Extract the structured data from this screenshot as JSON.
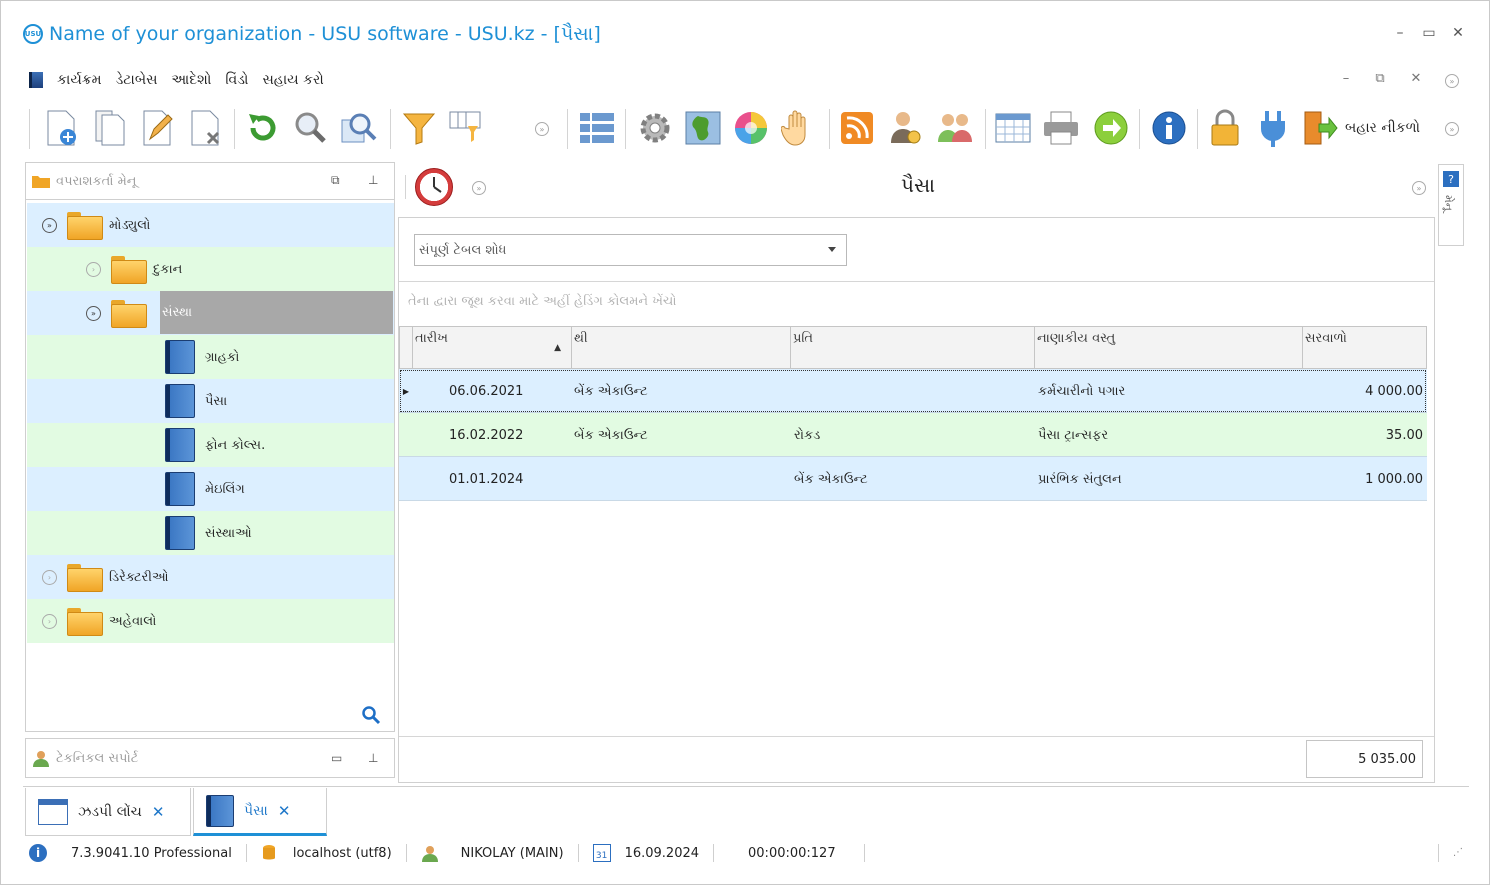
{
  "window": {
    "title": "Name of your organization - USU software - USU.kz - [પૈસા]",
    "logo_text": "USU"
  },
  "menu": {
    "items": [
      "કાર્યક્રમ",
      "ડેટાબેસ",
      "આદેશો",
      "વિંડો",
      "સહાય કરો"
    ]
  },
  "toolbar": {
    "exit_label": "બહાર નીકળો"
  },
  "left_panel": {
    "title": "વપરાશકર્તા મેનૂ",
    "tree": {
      "modules": "મોડ્યુલો",
      "shop": "દુકાન",
      "organization": "સંસ્થા",
      "clients": "ગ્રાહકો",
      "money": "પૈસા",
      "calls": "ફોન કોલ્સ.",
      "mailing": "મેઇલિંગ",
      "organizations": "સંસ્થાઓ",
      "directories": "ડિરેક્ટરીઓ",
      "reports": "અહેવાલો"
    }
  },
  "tech_support": {
    "title": "ટેકનિકલ સપોર્ટ"
  },
  "side_tab": {
    "label": "મેનૂ"
  },
  "main": {
    "title": "પૈસા",
    "search_placeholder": "સંપૂર્ણ ટેબલ શોધ",
    "group_hint": "તેના દ્વારા જૂથ કરવા માટે અહીં હેડિંગ કોલમને ખેંચો",
    "columns": {
      "date": "તારીખ",
      "from": "થી",
      "to": "પ્રતિ",
      "item": "નાણાકીય વસ્તુ",
      "total": "સરવાળો"
    },
    "rows": [
      {
        "date": "06.06.2021",
        "from": "બેંક એકાઉન્ટ",
        "to": "",
        "item": "કર્મચારીનો પગાર",
        "total": "4 000.00"
      },
      {
        "date": "16.02.2022",
        "from": "બેંક એકાઉન્ટ",
        "to": "રોકડ",
        "item": "પૈસા ટ્રાન્સફર",
        "total": "35.00"
      },
      {
        "date": "01.01.2024",
        "from": "",
        "to": "બેંક એકાઉન્ટ",
        "item": "પ્રારંભિક સંતુલન",
        "total": "1 000.00"
      }
    ],
    "sum": "5 035.00"
  },
  "tabs": {
    "quick_launch": "ઝડપી લોંચ",
    "money": "પૈસા"
  },
  "status": {
    "version": "7.3.9041.10 Professional",
    "db": "localhost (utf8)",
    "user": "NIKOLAY (MAIN)",
    "calendar_day": "31",
    "date": "16.09.2024",
    "timer": "00:00:00:127"
  }
}
